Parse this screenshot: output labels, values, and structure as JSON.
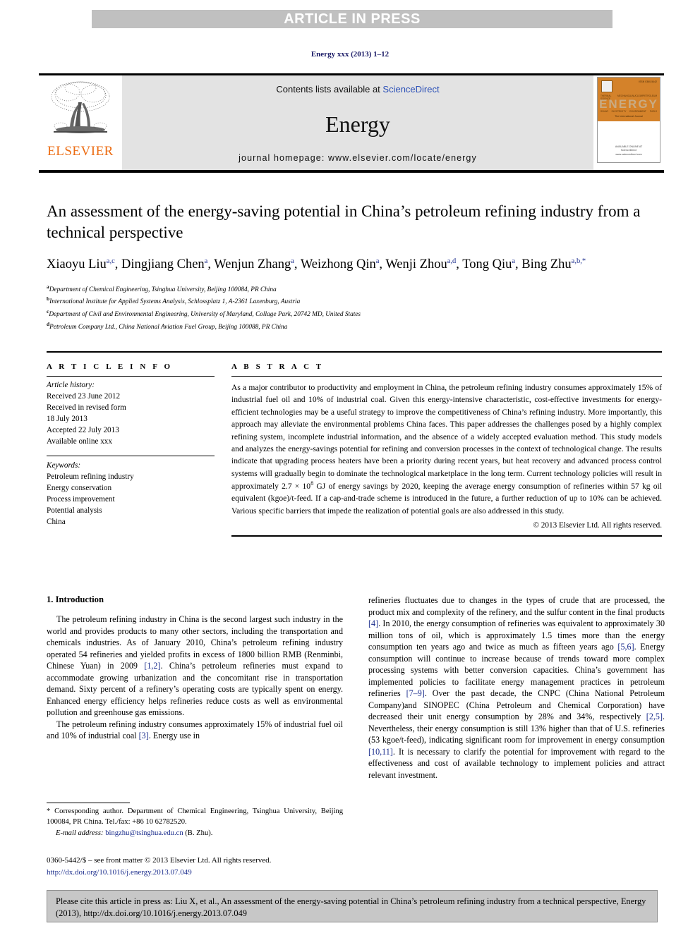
{
  "banner": {
    "label": "ARTICLE IN PRESS"
  },
  "running_head": "Energy xxx (2013) 1–12",
  "masthead": {
    "publisher": "ELSEVIER",
    "contents_prefix": "Contents lists available at ",
    "contents_link": "ScienceDirect",
    "journal_name": "Energy",
    "homepage": "journal homepage: www.elsevier.com/locate/energy",
    "cover": {
      "issn": "ISSN 0360-5442",
      "wordmark": "ENERGY",
      "top_labels": [
        "THERMAL SCIENCE",
        "MECHANICAL",
        "NUCLEAR",
        "PETROLEUM"
      ],
      "bottom_labels": [
        "SOLAR",
        "ELECTRICITY",
        "ENVIRONMENT",
        "FUELS"
      ],
      "tagline": "The International Journal",
      "footer": "AVAILABLE ONLINE AT\nScienceDirect\nwww.sciencedirect.com"
    }
  },
  "article": {
    "title": "An assessment of the energy-saving potential in China’s petroleum refining industry from a technical perspective",
    "authors": [
      {
        "name": "Xiaoyu Liu",
        "sup": "a,c",
        "sep": ", "
      },
      {
        "name": "Dingjiang Chen",
        "sup": "a",
        "sep": ", "
      },
      {
        "name": "Wenjun Zhang",
        "sup": "a",
        "sep": ", "
      },
      {
        "name": "Weizhong Qin",
        "sup": "a",
        "sep": ", "
      },
      {
        "name": "Wenji Zhou",
        "sup": "a,d",
        "sep": ", "
      },
      {
        "name": "Tong Qiu",
        "sup": "a",
        "sep": ", "
      },
      {
        "name": "Bing Zhu",
        "sup": "a,b,*",
        "sep": ""
      }
    ],
    "affiliations": [
      {
        "mark": "a",
        "text": "Department of Chemical Engineering, Tsinghua University, Beijing 100084, PR China"
      },
      {
        "mark": "b",
        "text": "International Institute for Applied Systems Analysis, Schlossplatz 1, A-2361 Laxenburg, Austria"
      },
      {
        "mark": "c",
        "text": "Department of Civil and Environmental Engineering, University of Maryland, Collage Park, 20742 MD, United States"
      },
      {
        "mark": "d",
        "text": "Petroleum Company Ltd., China National Aviation Fuel Group, Beijing 100088, PR China"
      }
    ]
  },
  "article_info": {
    "heading": "A R T I C L E    I N F O",
    "history_label": "Article history:",
    "history": [
      "Received 23 June 2012",
      "Received in revised form",
      "18 July 2013",
      "Accepted 22 July 2013",
      "Available online xxx"
    ],
    "keywords_label": "Keywords:",
    "keywords": [
      "Petroleum refining industry",
      "Energy conservation",
      "Process improvement",
      "Potential analysis",
      "China"
    ]
  },
  "abstract": {
    "heading": "A B S T R A C T",
    "text": "As a major contributor to productivity and employment in China, the petroleum refining industry consumes approximately 15% of industrial fuel oil and 10% of industrial coal. Given this energy-intensive characteristic, cost-effective investments for energy-efficient technologies may be a useful strategy to improve the competitiveness of China’s refining industry. More importantly, this approach may alleviate the environmental problems China faces. This paper addresses the challenges posed by a highly complex refining system, incomplete industrial information, and the absence of a widely accepted evaluation method. This study models and analyzes the energy-savings potential for refining and conversion processes in the context of technological change. The results indicate that upgrading process heaters have been a priority during recent years, but heat recovery and advanced process control systems will gradually begin to dominate the technological marketplace in the long term. Current technology policies will result in approximately 2.7 × 10⁸ GJ of energy savings by 2020, keeping the average energy consumption of refineries within 57 kg oil equivalent (kgoe)/t-feed. If a cap-and-trade scheme is introduced in the future, a further reduction of up to 10% can be achieved. Various specific barriers that impede the realization of potential goals are also addressed in this study.",
    "copyright": "© 2013 Elsevier Ltd. All rights reserved."
  },
  "introduction": {
    "section_number": "1.",
    "section_title": "Introduction",
    "left_paragraphs": [
      "The petroleum refining industry in China is the second largest such industry in the world and provides products to many other sectors, including the transportation and chemicals industries. As of January 2010, China’s petroleum refining industry operated 54 refineries and yielded profits in excess of 1800 billion RMB (Renminbi, Chinese Yuan) in 2009 [1,2]. China’s petroleum refineries must expand to accommodate growing urbanization and the concomitant rise in transportation demand. Sixty percent of a refinery’s operating costs are typically spent on energy. Enhanced energy efficiency helps refineries reduce costs as well as environmental pollution and greenhouse gas emissions.",
      "The petroleum refining industry consumes approximately 15% of industrial fuel oil and 10% of industrial coal [3]. Energy use in"
    ],
    "right_paragraphs": [
      "refineries fluctuates due to changes in the types of crude that are processed, the product mix and complexity of the refinery, and the sulfur content in the final products [4]. In 2010, the energy consumption of refineries was equivalent to approximately 30 million tons of oil, which is approximately 1.5 times more than the energy consumption ten years ago and twice as much as fifteen years ago [5,6]. Energy consumption will continue to increase because of trends toward more complex processing systems with better conversion capacities. China’s government has implemented policies to facilitate energy management practices in petroleum refineries [7–9]. Over the past decade, the CNPC (China National Petroleum Company)and SINOPEC (China Petroleum and Chemical Corporation) have decreased their unit energy consumption by 28% and 34%, respectively [2,5]. Nevertheless, their energy consumption is still 13% higher than that of U.S. refineries (53 kgoe/t-feed), indicating significant room for improvement in energy consumption [10,11]. It is necessary to clarify the potential for improvement with regard to the effectiveness and cost of available technology to implement policies and attract relevant investment."
    ]
  },
  "footnote": {
    "corresponding": "* Corresponding author. Department of Chemical Engineering, Tsinghua University, Beijing 100084, PR China. Tel./fax: +86 10 62782520.",
    "email_label": "E-mail address:",
    "email": "bingzhu@tsinghua.edu.cn",
    "email_suffix": "(B. Zhu)."
  },
  "issn_line": {
    "text": "0360-5442/$ – see front matter © 2013 Elsevier Ltd. All rights reserved.",
    "doi": "http://dx.doi.org/10.1016/j.energy.2013.07.049"
  },
  "citation_box": {
    "text": "Please cite this article in press as: Liu X, et al., An assessment of the energy-saving potential in China’s petroleum refining industry from a technical perspective, Energy (2013), http://dx.doi.org/10.1016/j.energy.2013.07.049"
  },
  "colors": {
    "banner_bg": "#c0c0c0",
    "elsevier_orange": "#ec6d14",
    "link_blue": "#2a4fb7",
    "ref_blue": "#1a2c8c",
    "masthead_bg": "#e3e3e3",
    "citation_bg": "#c7c7c7",
    "cover_orange": "#d4822a"
  }
}
